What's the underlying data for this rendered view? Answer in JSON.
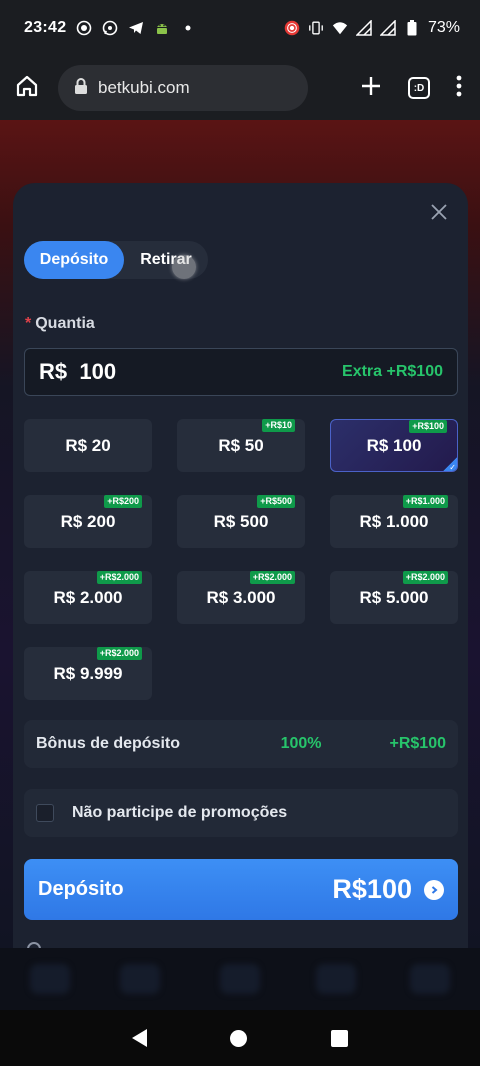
{
  "status_bar": {
    "time": "23:42",
    "battery_percent": "73%",
    "left_icons": [
      "record-icon",
      "whatsapp-icon",
      "telegram-icon",
      "android-icon",
      "dot-icon"
    ],
    "right_icons": [
      "screen-record-icon",
      "vibrate-icon",
      "wifi-icon",
      "signal-icon",
      "signal-icon",
      "battery-icon"
    ]
  },
  "browser": {
    "url": "betkubi.com",
    "tab_count": ":D"
  },
  "modal": {
    "tabs": [
      {
        "label": "Depósito",
        "active": true
      },
      {
        "label": "Retirar",
        "active": false
      }
    ],
    "amount_label": "Quantia",
    "amount_value": "R$  100",
    "amount_extra": "Extra +R$100",
    "amount_options": [
      {
        "label": "R$ 20",
        "bonus": ""
      },
      {
        "label": "R$ 50",
        "bonus": "+R$10"
      },
      {
        "label": "R$ 100",
        "bonus": "+R$100",
        "selected": true
      },
      {
        "label": "R$ 200",
        "bonus": "+R$200"
      },
      {
        "label": "R$ 500",
        "bonus": "+R$500"
      },
      {
        "label": "R$ 1.000",
        "bonus": "+R$1.000"
      },
      {
        "label": "R$ 2.000",
        "bonus": "+R$2.000"
      },
      {
        "label": "R$ 3.000",
        "bonus": "+R$2.000"
      },
      {
        "label": "R$ 5.000",
        "bonus": "+R$2.000"
      },
      {
        "label": "R$ 9.999",
        "bonus": "+R$2.000"
      }
    ],
    "bonus_row": {
      "label": "Bônus de depósito",
      "percent": "100%",
      "amount": "+R$100"
    },
    "optout": {
      "label": "Não participe de promoções",
      "checked": false
    },
    "deposit_button": {
      "label": "Depósito",
      "amount": "R$100"
    }
  },
  "colors": {
    "accent": "#3a86f0",
    "bonus_green": "#27c46b",
    "panel": "#1c2230",
    "card": "#262d3b"
  }
}
